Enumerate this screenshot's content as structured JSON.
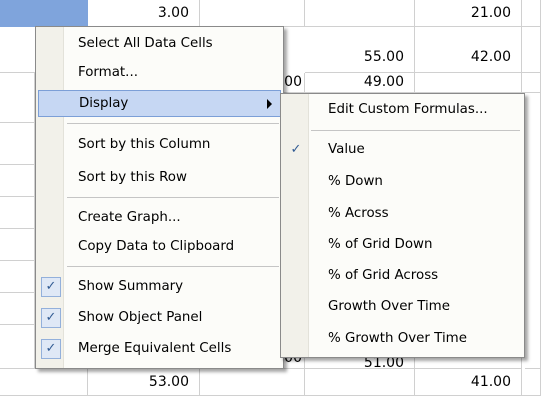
{
  "background_values": {
    "v_a1": "3.00",
    "v_d1": "21.00",
    "v_c2": "55.00",
    "v_d2": "42.00",
    "v_b3_fragment": "00",
    "v_c3": "49.00",
    "v_b12_fragment": "00",
    "v_c12_fragment": "51.00",
    "v_a13": "53.00",
    "v_d13": "41.00"
  },
  "context_menu": {
    "items": [
      {
        "label": "Select All Data Cells"
      },
      {
        "label": "Format..."
      },
      {
        "label": "Display"
      },
      {
        "label": "Sort by this Column"
      },
      {
        "label": "Sort by this Row"
      },
      {
        "label": "Create Graph..."
      },
      {
        "label": "Copy Data to Clipboard"
      },
      {
        "label": "Show Summary",
        "checked": true
      },
      {
        "label": "Show Object Panel",
        "checked": true
      },
      {
        "label": "Merge Equivalent Cells",
        "checked": true
      }
    ],
    "check_glyph": "✓"
  },
  "display_submenu": {
    "items": [
      {
        "label": "Edit Custom Formulas..."
      },
      {
        "label": "Value",
        "checked": true
      },
      {
        "label": "% Down"
      },
      {
        "label": "% Across"
      },
      {
        "label": "% of Grid Down"
      },
      {
        "label": "% of Grid Across"
      },
      {
        "label": "Growth Over Time"
      },
      {
        "label": "% Growth Over Time"
      }
    ],
    "check_glyph": "✓"
  },
  "colors": {
    "selection": "#7fa4dc",
    "highlight": "#c6d7f3",
    "highlight_border": "#7c9fd7"
  }
}
